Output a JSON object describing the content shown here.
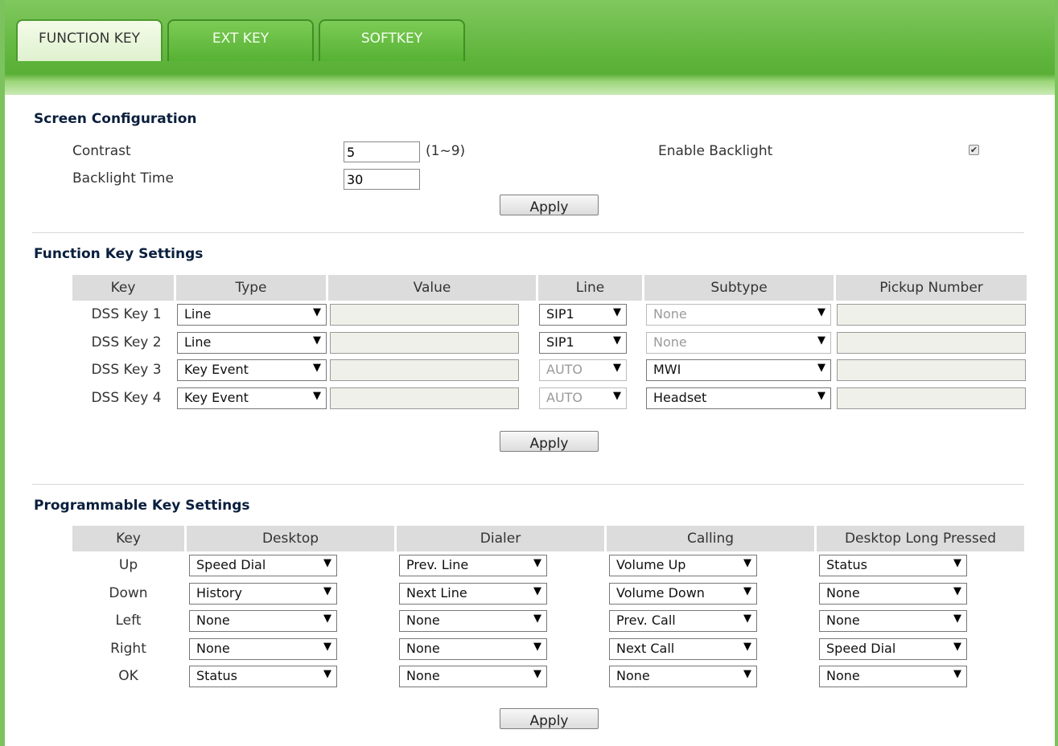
{
  "tabs": [
    {
      "label": "FUNCTION KEY",
      "active": true
    },
    {
      "label": "EXT KEY",
      "active": false
    },
    {
      "label": "SOFTKEY",
      "active": false
    }
  ],
  "screen_config": {
    "title": "Screen Configuration",
    "contrast_label": "Contrast",
    "contrast_value": "5",
    "contrast_range": "(1~9)",
    "backlight_time_label": "Backlight Time",
    "backlight_time_value": "30",
    "enable_backlight_label": "Enable Backlight",
    "enable_backlight_checked": true,
    "apply_label": "Apply"
  },
  "function_keys": {
    "title": "Function Key Settings",
    "headers": [
      "Key",
      "Type",
      "Value",
      "Line",
      "Subtype",
      "Pickup Number"
    ],
    "rows": [
      {
        "key": "DSS Key 1",
        "type": "Line",
        "value": "",
        "line": "SIP1",
        "line_disabled": false,
        "subtype": "None",
        "subtype_disabled": true,
        "pickup": ""
      },
      {
        "key": "DSS Key 2",
        "type": "Line",
        "value": "",
        "line": "SIP1",
        "line_disabled": false,
        "subtype": "None",
        "subtype_disabled": true,
        "pickup": ""
      },
      {
        "key": "DSS Key 3",
        "type": "Key Event",
        "value": "",
        "line": "AUTO",
        "line_disabled": true,
        "subtype": "MWI",
        "subtype_disabled": false,
        "pickup": ""
      },
      {
        "key": "DSS Key 4",
        "type": "Key Event",
        "value": "",
        "line": "AUTO",
        "line_disabled": true,
        "subtype": "Headset",
        "subtype_disabled": false,
        "pickup": ""
      }
    ],
    "apply_label": "Apply"
  },
  "programmable_keys": {
    "title": "Programmable Key Settings",
    "headers": [
      "Key",
      "Desktop",
      "Dialer",
      "Calling",
      "Desktop Long Pressed"
    ],
    "rows": [
      {
        "key": "Up",
        "desktop": "Speed Dial",
        "dialer": "Prev. Line",
        "calling": "Volume Up",
        "long": "Status"
      },
      {
        "key": "Down",
        "desktop": "History",
        "dialer": "Next Line",
        "calling": "Volume Down",
        "long": "None"
      },
      {
        "key": "Left",
        "desktop": "None",
        "dialer": "None",
        "calling": "Prev. Call",
        "long": "None"
      },
      {
        "key": "Right",
        "desktop": "None",
        "dialer": "None",
        "calling": "Next Call",
        "long": "Speed Dial"
      },
      {
        "key": "OK",
        "desktop": "Status",
        "dialer": "None",
        "calling": "None",
        "long": "None"
      }
    ],
    "apply_label": "Apply"
  },
  "icons": {
    "dropdown_arrow": "chevron-down-icon",
    "checkmark": "check-icon"
  },
  "colors": {
    "header_green": "#5fb53c",
    "frame_green": "#7cc35e",
    "table_header_bg": "#dcdcdc"
  }
}
